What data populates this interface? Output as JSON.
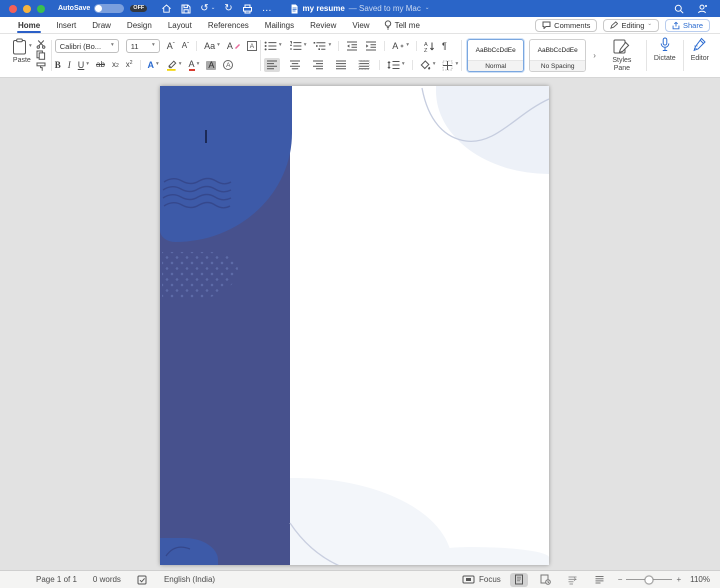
{
  "icons": {
    "caret": "▾",
    "chevron": "⌄",
    "ellipsis": "…",
    "undo": "↺",
    "redo": "↻",
    "pilcrow": "¶",
    "updown": "↕",
    "plus": "+",
    "minus": "−",
    "expander": "›"
  },
  "titlebar": {
    "autosave": "AutoSave",
    "autosave_state": "OFF",
    "title": "my resume",
    "saved": "— Saved to my Mac"
  },
  "tabs": {
    "items": [
      {
        "label": "Home"
      },
      {
        "label": "Insert"
      },
      {
        "label": "Draw"
      },
      {
        "label": "Design"
      },
      {
        "label": "Layout"
      },
      {
        "label": "References"
      },
      {
        "label": "Mailings"
      },
      {
        "label": "Review"
      },
      {
        "label": "View"
      }
    ],
    "tellme": "Tell me"
  },
  "actions": {
    "comments": "Comments",
    "editing": "Editing",
    "share": "Share"
  },
  "ribbon": {
    "paste": "Paste",
    "font_name": "Calibri (Bo...",
    "font_size": "11",
    "glyphs": {
      "grow": "A",
      "grow_mark": "ˆ",
      "shrink": "A",
      "shrink_mark": "ˇ",
      "case": "Aa",
      "clear": "A",
      "boxed": "A",
      "bold": "B",
      "italic": "I",
      "underline": "U",
      "strike": "ab",
      "sub": "x",
      "sub_s": "2",
      "sup": "x",
      "sup_s": "2",
      "effects": "A",
      "fontcolor": "A",
      "shading_a": "A",
      "enclose": "A",
      "sparkle": "A"
    },
    "styles": {
      "preview1": "AaBbCcDdEe",
      "name1": "Normal",
      "preview2": "AaBbCcDdEe",
      "name2": "No Spacing",
      "pane": "Styles Pane"
    },
    "dictate": "Dictate",
    "editor": "Editor"
  },
  "statusbar": {
    "page": "Page 1 of 1",
    "words": "0 words",
    "language": "English (India)",
    "focus": "Focus",
    "zoom": "110%"
  },
  "colors": {
    "titlebar": "#2a65c8",
    "accent": "#2b6bd0",
    "panel_dark": "#47518d",
    "panel_blob": "#3d5aa8"
  }
}
